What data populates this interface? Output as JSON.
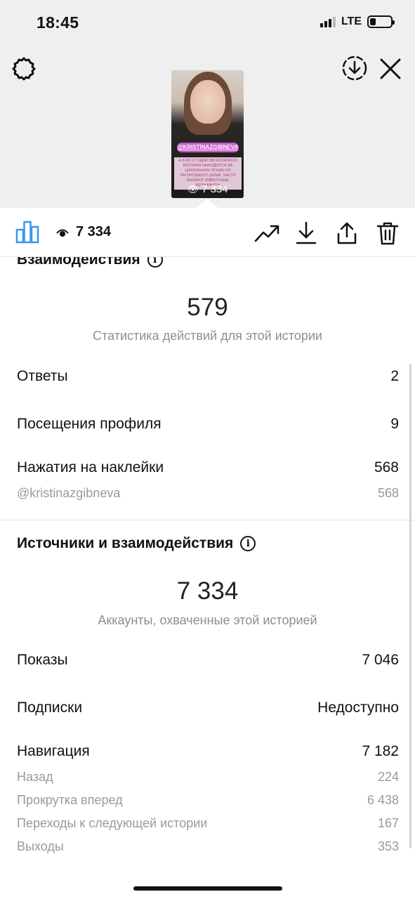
{
  "status": {
    "time": "18:45",
    "network": "LTE",
    "battery_level": 0.2
  },
  "story": {
    "tag": "@KRISTINAZGIBNEVA",
    "caption": "А В ИХ СТУДИИ ЗВУКОЗАПИСИ КОТОРАЯ НАХОДИТСЯ НА ЦОКОЛЬНОМ ЭТАЖЕ ИХ ЗАГОРОДНОГО ДОМА, ЧАСТО БЫВАЮТ ИЗВЕСТНЫЕ МУЗЫКАНТЫ",
    "views": "7 334"
  },
  "toolbar": {
    "views": "7 334"
  },
  "interactions": {
    "title": "Взаимодействия",
    "total": "579",
    "subtitle": "Статистика действий для этой истории",
    "rows": [
      {
        "label": "Ответы",
        "value": "2"
      },
      {
        "label": "Посещения профиля",
        "value": "9"
      },
      {
        "label": "Нажатия на наклейки",
        "value": "568"
      }
    ],
    "sticker": {
      "label": "@kristinazgibneva",
      "value": "568"
    }
  },
  "discovery": {
    "title": "Источники и взаимодействия",
    "total": "7 334",
    "subtitle": "Аккаунты, охваченные этой историей",
    "rows": [
      {
        "label": "Показы",
        "value": "7 046"
      },
      {
        "label": "Подписки",
        "value": "Недоступно"
      },
      {
        "label": "Навигация",
        "value": "7 182"
      }
    ],
    "navigation": [
      {
        "label": "Назад",
        "value": "224"
      },
      {
        "label": "Прокрутка вперед",
        "value": "6 438"
      },
      {
        "label": "Переходы к следующей истории",
        "value": "167"
      },
      {
        "label": "Выходы",
        "value": "353"
      }
    ]
  },
  "icons": {
    "settings": "gear-icon",
    "download_story": "circle-download-icon",
    "close": "close-icon",
    "insights": "bar-chart-icon",
    "views": "eye-icon",
    "promote": "trend-icon",
    "save": "download-icon",
    "share": "share-icon",
    "delete": "trash-icon",
    "info": "info-icon"
  },
  "colors": {
    "accent": "#3897f0",
    "tag": "#c85bc9"
  }
}
